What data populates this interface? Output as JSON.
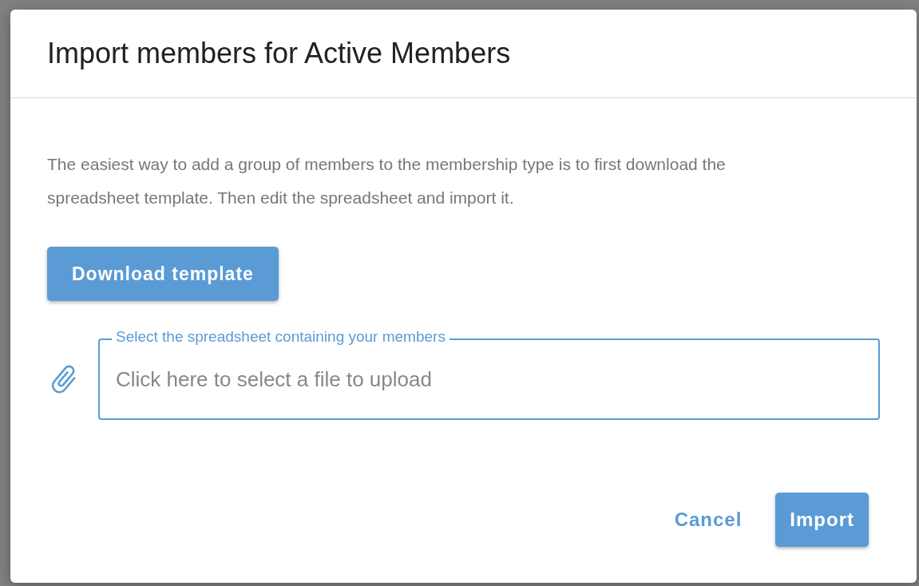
{
  "dialog": {
    "title": "Import members for Active Members",
    "description": "The easiest way to add a group of members to the membership type is to first download the spreadsheet template. Then edit the spreadsheet and import it.",
    "download_button": "Download template",
    "file_field": {
      "label": "Select the spreadsheet containing your members",
      "placeholder": "Click here to select a file to upload"
    },
    "buttons": [
      {
        "label": "Cancel",
        "kind": "text"
      },
      {
        "label": "Import",
        "kind": "filled"
      }
    ]
  }
}
